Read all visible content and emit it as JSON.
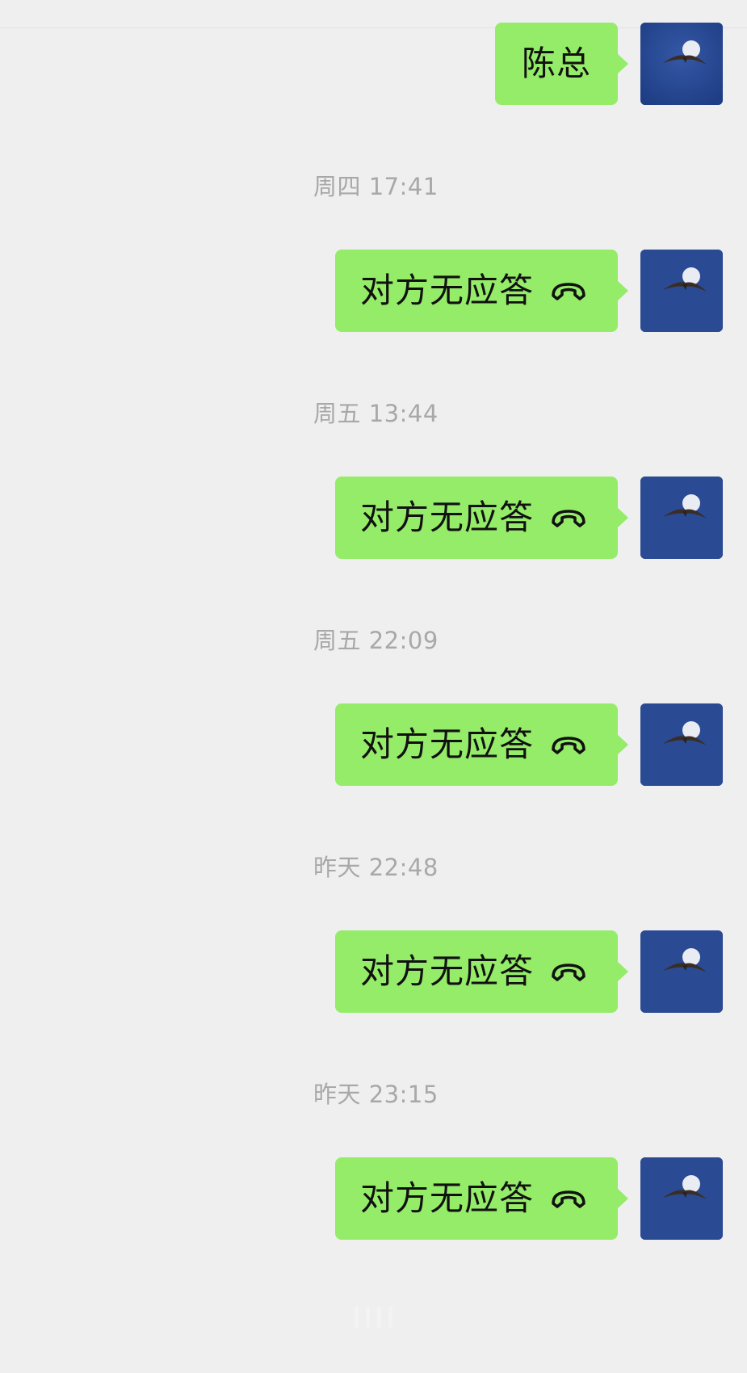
{
  "chat": {
    "first_message": {
      "text": "陈总",
      "sender": "self"
    },
    "entries": [
      {
        "time": "周四 17:41",
        "text": "对方无应答",
        "icon": "phone-hangup-icon"
      },
      {
        "time": "周五 13:44",
        "text": "对方无应答",
        "icon": "phone-hangup-icon"
      },
      {
        "time": "周五 22:09",
        "text": "对方无应答",
        "icon": "phone-hangup-icon"
      },
      {
        "time": "昨天 22:48",
        "text": "对方无应答",
        "icon": "phone-hangup-icon"
      },
      {
        "time": "昨天 23:15",
        "text": "对方无应答",
        "icon": "phone-hangup-icon"
      }
    ]
  },
  "colors": {
    "background": "#efefef",
    "bubble": "#95ec69",
    "timestamp": "#a8a8a8",
    "avatar": "#2b4c94"
  },
  "icons": {
    "avatar": "avatar-moon-bird-icon",
    "call": "phone-hangup-icon"
  }
}
